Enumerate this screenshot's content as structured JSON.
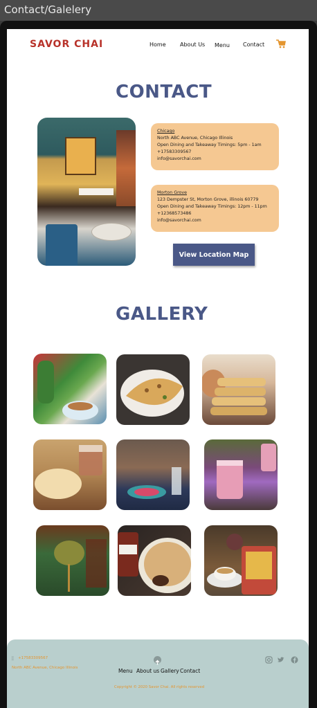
{
  "window": {
    "title": "Contact/Galelery"
  },
  "header": {
    "logo_text": "SAVOR CHAI",
    "nav": [
      "Home",
      "About Us",
      "Menu",
      "Contact"
    ],
    "cart_icon": "cart-icon",
    "accent": "#e4952f"
  },
  "contact": {
    "title": "CONTACT",
    "locations": [
      {
        "name": "Chicago",
        "address": "North ABC Avenue, Chicago Illinois",
        "timings": "Open Dining and Takeaway Timings: 5pm - 1am",
        "phone": "+17583309567",
        "email": "info@savorchai.com"
      },
      {
        "name": "Morton Grove",
        "address": "123 Dempster St, Morton Grove, illinois 60779",
        "timings": "Open Dining and Takeaway Timings: 12pm - 11pm",
        "phone": "+12368573486",
        "email": "info@savorchai.com"
      }
    ],
    "map_button": "View Location Map"
  },
  "gallery": {
    "title": "GALLERY",
    "photos": [
      "cactus-and-chai-cup",
      "paratha-on-plate",
      "stacked-parathas",
      "chai-and-flatbread",
      "dining-table-setting",
      "pink-chai-glasses",
      "pouring-tea",
      "nutella-paratha",
      "teapot-and-cups"
    ]
  },
  "footer": {
    "phone": "+17583309567",
    "address": "North ABC Avenue, Chicago Illinois",
    "nav": [
      "Menu",
      "About us",
      "Gallery",
      "Contact"
    ],
    "copyright": "Copyright © 2020 Savor Chai. All rights reserved",
    "social_icons": [
      "instagram-icon",
      "twitter-icon",
      "facebook-icon"
    ]
  },
  "colors": {
    "title_blue": "#4a5887",
    "card_orange": "#f5c892",
    "footer_teal": "#b9cfcd",
    "logo_red": "#b8322a"
  }
}
